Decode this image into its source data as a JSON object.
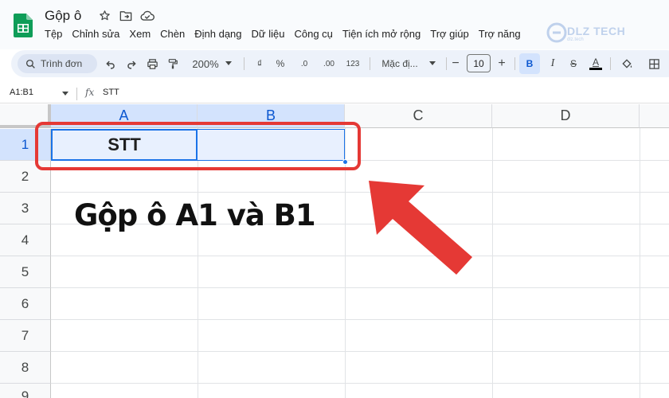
{
  "titlebar": {
    "doc_title": "Gộp ô",
    "menus": [
      "Tệp",
      "Chỉnh sửa",
      "Xem",
      "Chèn",
      "Định dạng",
      "Dữ liệu",
      "Công cụ",
      "Tiện ích mở rộng",
      "Trợ giúp",
      "Trợ năng"
    ]
  },
  "watermark": {
    "text": "DLZ TECH",
    "sub": "dlz.tech"
  },
  "toolbar": {
    "search_placeholder": "Trình đơn",
    "zoom": "200%",
    "currency": "₫",
    "percent": "%",
    "dec_decrease": ".0",
    "dec_increase": ".00",
    "number_format": "123",
    "font_family": "Mặc đị...",
    "font_size": "10",
    "minus": "−",
    "plus": "+",
    "bold": "B",
    "italic": "I",
    "strike": "S",
    "text_color": "A"
  },
  "formula_bar": {
    "name_box": "A1:B1",
    "fx": "fx",
    "content": "STT"
  },
  "grid": {
    "columns": [
      "A",
      "B",
      "C",
      "D"
    ],
    "rows": [
      "1",
      "2",
      "3",
      "4",
      "5",
      "6",
      "7",
      "8",
      "9"
    ],
    "cell_a1": "STT"
  },
  "annotation": {
    "text": "Gộp ô A1 và B1"
  },
  "colors": {
    "selection": "#1a73e8",
    "selection_fill": "#e8f0fe",
    "highlight_red": "#e53935",
    "sheets_green": "#0f9d58"
  }
}
